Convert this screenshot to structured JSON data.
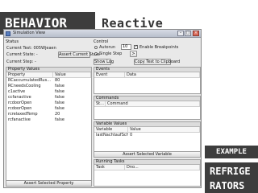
{
  "slide": {
    "title_tag": "Behavior",
    "subtitle": "Reactive",
    "example_tag": "Example",
    "topic_tag": "Refrige rators"
  },
  "window": {
    "title": "Simulation View",
    "buttons": {
      "minimize": "–",
      "maximize": "□",
      "close": "×"
    }
  },
  "status": {
    "header": "Status",
    "current_test": "Current Test: 005Wjeaen",
    "current_state": "Current State: -",
    "current_step": "Current Step: -",
    "assert_state_btn": "Assert Current State"
  },
  "control": {
    "header": "Control",
    "autorun": "Autorun",
    "single_step": "Single Step",
    "spin_value": "10",
    "enable_breakpoints": "Enable Breakpoints",
    "next_btn": ">",
    "show_log_btn": "Show Log",
    "copy_btn": "Copy Test to Clipboard"
  },
  "property_values": {
    "header": "Property Values",
    "columns": [
      "Property",
      "Value"
    ],
    "rows": [
      [
        "RCaccumulatedRus...",
        "80"
      ],
      [
        "RCneedsCooling",
        "false"
      ],
      [
        "c1active",
        "false"
      ],
      [
        "ccfanactive",
        "false"
      ],
      [
        "rcdoorOpen",
        "false"
      ],
      [
        "rcdoorOpen",
        "false"
      ],
      [
        "rcrelaxedTemp",
        "20"
      ],
      [
        "rcfanactive",
        "false"
      ]
    ],
    "button": "Assert Selected Property"
  },
  "events": {
    "header": "Events",
    "columns": [
      "Event",
      "Data"
    ]
  },
  "commands": {
    "header": "Commands",
    "columns": [
      "St...",
      "Command"
    ]
  },
  "variable_values": {
    "header": "Variable Values",
    "columns": [
      "Variable",
      "Value"
    ],
    "rows": [
      [
        "lastNachtaufSchwel...",
        "0"
      ]
    ],
    "button": "Assert Selected Variable"
  },
  "running_tasks": {
    "header": "Running Tasks",
    "columns": [
      "Task",
      "Dno..."
    ]
  }
}
